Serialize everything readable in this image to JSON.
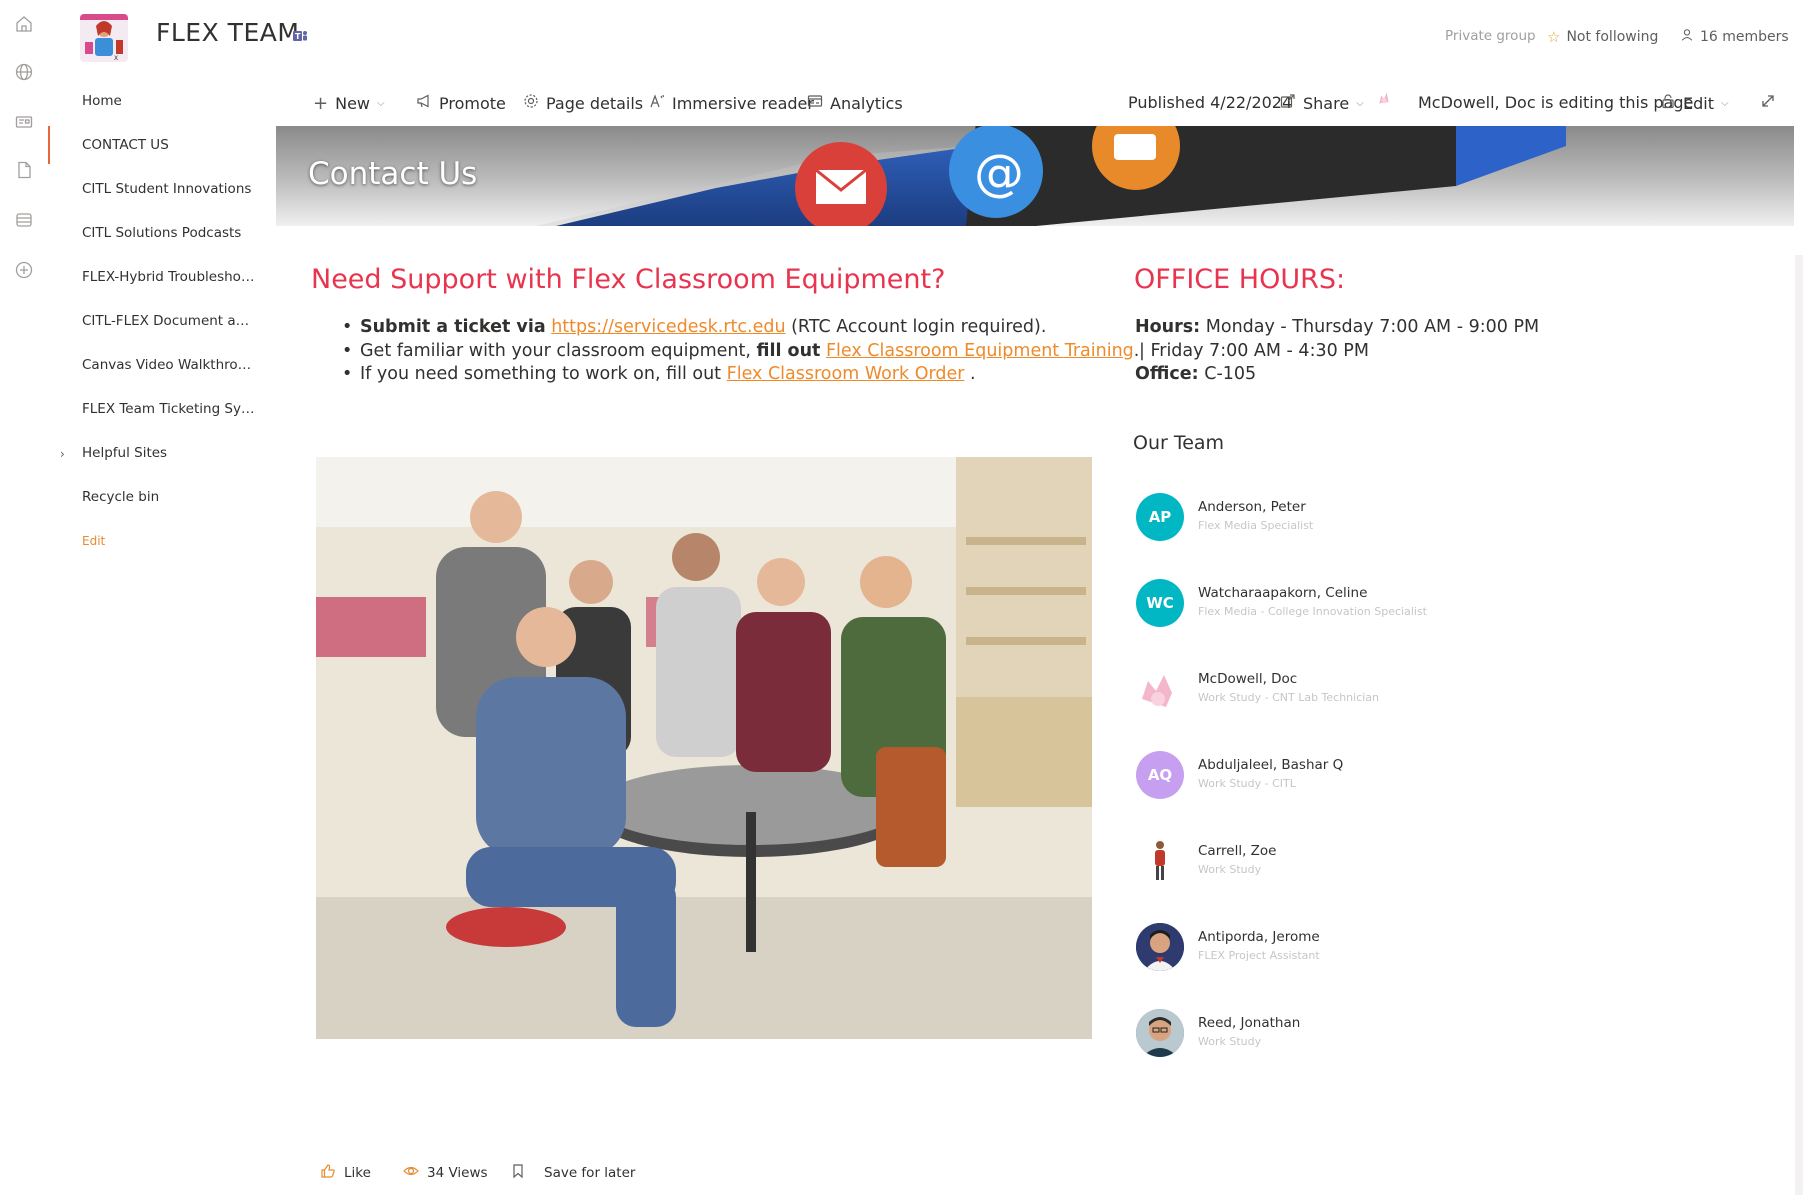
{
  "site": {
    "title": "FLEX TEAM",
    "privacy": "Private group",
    "follow_label": "Not following",
    "members_label": "16 members"
  },
  "nav": {
    "items": [
      {
        "label": "Home"
      },
      {
        "label": "CONTACT US"
      },
      {
        "label": "CITL Student Innovations"
      },
      {
        "label": "CITL Solutions Podcasts"
      },
      {
        "label": "FLEX-Hybrid Troubleshoo..."
      },
      {
        "label": "CITL-FLEX Document and..."
      },
      {
        "label": "Canvas Video Walkthrou..."
      },
      {
        "label": "FLEX Team Ticketing Syst..."
      },
      {
        "label": "Helpful Sites"
      },
      {
        "label": "Recycle bin"
      }
    ],
    "edit_label": "Edit"
  },
  "commandbar": {
    "new_label": "New",
    "promote_label": "Promote",
    "page_details_label": "Page details",
    "immersive_reader_label": "Immersive reader",
    "analytics_label": "Analytics",
    "published_label": "Published 4/22/2024",
    "share_label": "Share",
    "editing_label": "McDowell, Doc is editing this page",
    "edit_label": "Edit"
  },
  "banner": {
    "title": "Contact Us"
  },
  "support": {
    "headline": "Need Support with Flex Classroom Equipment?",
    "line1_bold": "Submit a ticket via",
    "line1_link": "https://servicedesk.rtc.edu",
    "line1_rest": "(RTC Account login required).",
    "line2_pre": "Get familiar with your classroom equipment,",
    "line2_bold": "fill out",
    "line2_link": "Flex Classroom Equipment Training",
    "line2_end": ".",
    "line3_pre": "If you need something to work on, fill out",
    "line3_link": "Flex Classroom Work Order",
    "line3_end": "."
  },
  "office": {
    "headline": "OFFICE HOURS:",
    "hours_label": "Hours:",
    "hours_value": "Monday - Thursday 7:00 AM - 9:00 PM",
    "hours_line2": "|   Friday 7:00 AM - 4:30 PM",
    "office_label": "Office:",
    "office_value": "C-105"
  },
  "team": {
    "title": "Our Team",
    "members": [
      {
        "initials": "AP",
        "name": "Anderson, Peter",
        "role": "Flex Media Specialist",
        "color": "#00b7c3"
      },
      {
        "initials": "WC",
        "name": "Watcharaapakorn, Celine",
        "role": "Flex Media - College Innovation Specialist",
        "color": "#00b7c3"
      },
      {
        "initials": "",
        "name": "McDowell, Doc",
        "role": "Work Study - CNT Lab Technician",
        "color": "#f7c6d6"
      },
      {
        "initials": "AQ",
        "name": "Abduljaleel, Bashar Q",
        "role": "Work Study - CITL",
        "color": "#c79ff0"
      },
      {
        "initials": "",
        "name": "Carrell, Zoe",
        "role": "Work Study",
        "color": "#ffffff"
      },
      {
        "initials": "",
        "name": "Antiporda, Jerome",
        "role": "FLEX Project Assistant",
        "color": "#2f3b6e"
      },
      {
        "initials": "",
        "name": "Reed, Jonathan",
        "role": "Work Study",
        "color": "#5a7a8a"
      }
    ]
  },
  "footer": {
    "like_label": "Like",
    "views_label": "34 Views",
    "save_label": "Save for later"
  },
  "colors": {
    "accent": "#e8663a",
    "headline": "#e8344e",
    "link": "#ef8a2a",
    "persona_teal": "#00b7c3"
  }
}
